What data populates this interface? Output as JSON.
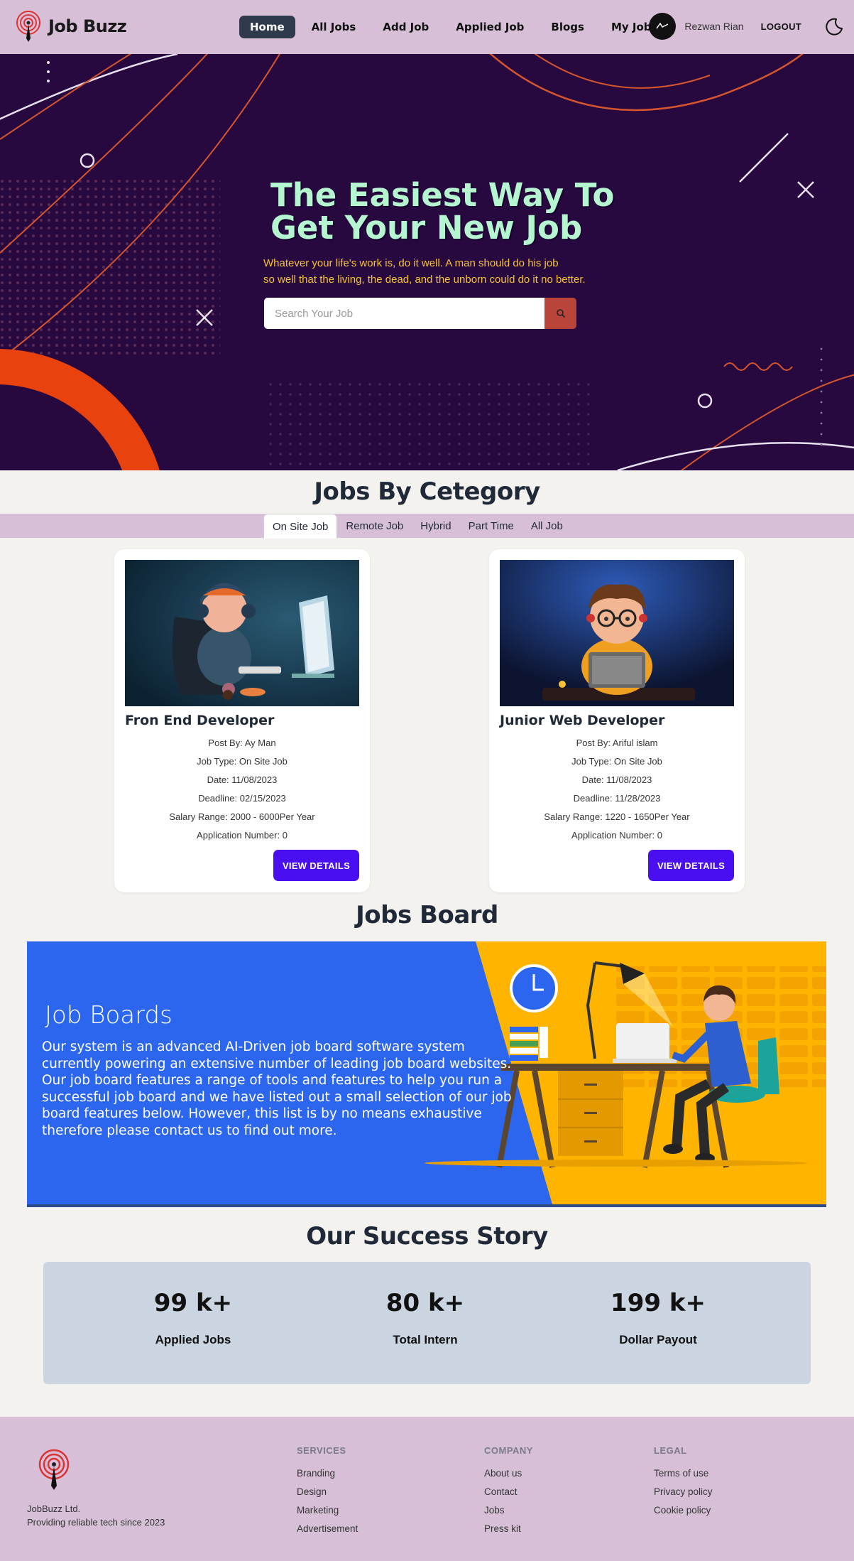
{
  "navbar": {
    "brand": "Job Buzz",
    "links": [
      {
        "label": "Home",
        "active": true
      },
      {
        "label": "All Jobs"
      },
      {
        "label": "Add Job"
      },
      {
        "label": "Applied Job"
      },
      {
        "label": "Blogs"
      },
      {
        "label": "My Job"
      }
    ],
    "user_name": "Rezwan Rian",
    "logout": "LOGOUT",
    "theme_icon": "moon-icon"
  },
  "hero": {
    "title": "The Easiest Way To\nGet Your New Job",
    "subtitle": "Whatever your life's work is, do it well. A man should do his job\nso well that the living, the dead, and the unborn could do it no better.",
    "search_placeholder": "Search Your Job",
    "search_icon": "search-icon"
  },
  "category": {
    "title": "Jobs By Cetegory",
    "tabs": [
      "On Site Job",
      "Remote Job",
      "Hybrid",
      "Part Time",
      "All Job"
    ],
    "active_tab": "On Site Job",
    "jobs": [
      {
        "title": "Fron End Developer",
        "post_by": "Post By: Ay Man",
        "job_type": "Job Type: On Site Job",
        "date": "Date: 11/08/2023",
        "deadline": "Deadline: 02/15/2023",
        "salary": "Salary Range: 2000 - 6000Per Year",
        "applications": "Application Number: 0",
        "button": "VIEW DETAILS"
      },
      {
        "title": "Junior Web Developer",
        "post_by": "Post By: Ariful islam",
        "job_type": "Job Type: On Site Job",
        "date": "Date: 11/08/2023",
        "deadline": "Deadline: 11/28/2023",
        "salary": "Salary Range: 1220 - 1650Per Year",
        "applications": "Application Number: 0",
        "button": "VIEW DETAILS"
      }
    ]
  },
  "board": {
    "section_title": "Jobs Board",
    "title": "Job Boards",
    "text": "Our system is an advanced AI-Driven job board software system currently powering an extensive number of leading job board websites. Our job board features a range of tools and features to help you run a successful job board and we have listed out a small selection of our job board features below. However, this list is by no means exhaustive therefore please contact us to find out more."
  },
  "success": {
    "title": "Our Success Story",
    "stats": [
      {
        "value": "99 k+",
        "label": "Applied Jobs"
      },
      {
        "value": "80 k+",
        "label": "Total Intern"
      },
      {
        "value": "199 k+",
        "label": "Dollar Payout"
      }
    ]
  },
  "footer": {
    "company_name": "JobBuzz Ltd.",
    "tagline": "Providing reliable tech since 2023",
    "columns": [
      {
        "title": "SERVICES",
        "links": [
          "Branding",
          "Design",
          "Marketing",
          "Advertisement"
        ]
      },
      {
        "title": "COMPANY",
        "links": [
          "About us",
          "Contact",
          "Jobs",
          "Press kit"
        ]
      },
      {
        "title": "LEGAL",
        "links": [
          "Terms of use",
          "Privacy policy",
          "Cookie policy"
        ]
      }
    ]
  },
  "colors": {
    "nav_bg": "#d8bfd8",
    "hero_bg": "#27093f",
    "hero_title": "#b5f5d0",
    "hero_subtitle": "#f7c234",
    "primary_button": "#4a0ff0",
    "search_button": "#b8443a",
    "board_blue": "#2d66ee",
    "board_yellow": "#ffb400",
    "stats_bg": "#cbd5e1"
  }
}
